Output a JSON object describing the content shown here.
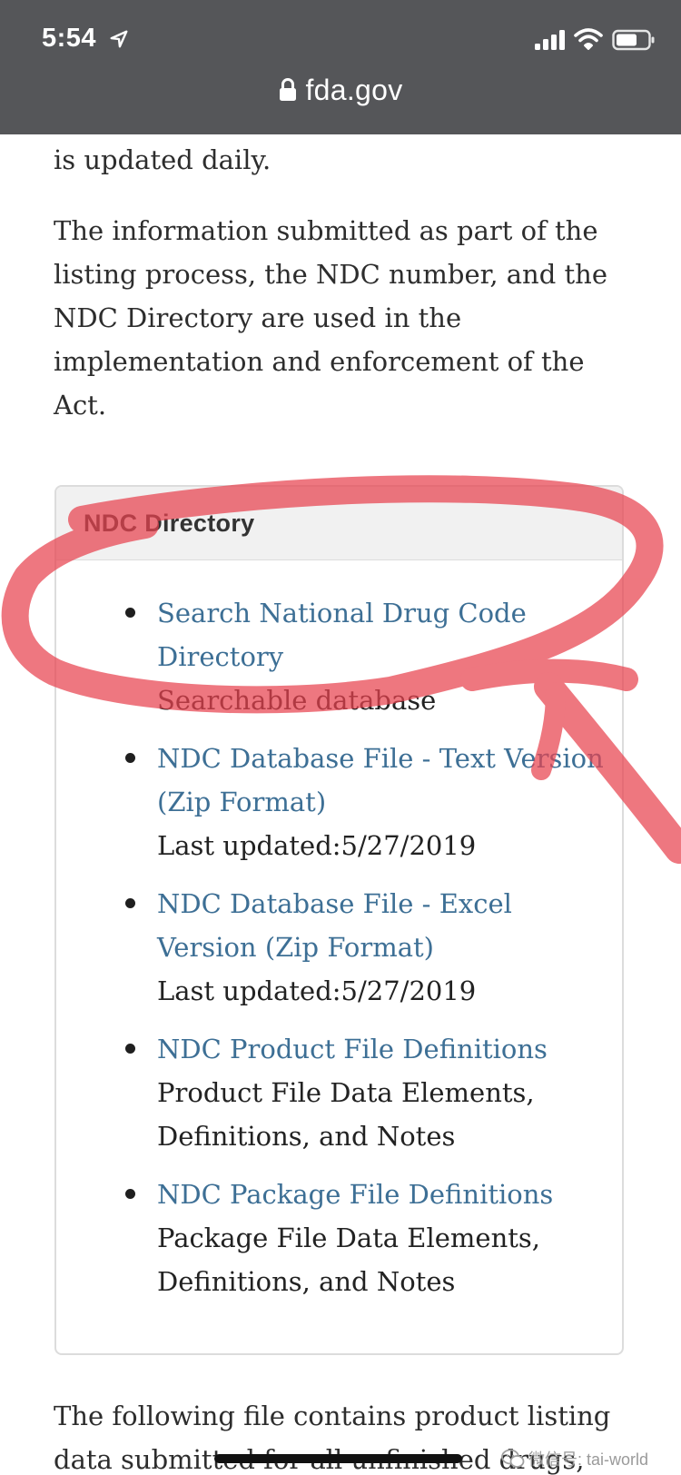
{
  "status_bar": {
    "time": "5:54",
    "icons": [
      "location-arrow-icon",
      "signal-icon",
      "wifi-icon",
      "battery-icon"
    ]
  },
  "browser": {
    "url": "fda.gov",
    "lock_icon": "lock-icon"
  },
  "content": {
    "para_top": "is updated daily.",
    "para_info": "The information submitted as part of the listing process, the NDC number, and the NDC Directory are used in the implementation and enforcement of the Act.",
    "para_bottom": "The following file contains product listing data submitted for all unfinished drugs,"
  },
  "card": {
    "title": "NDC Directory",
    "items": [
      {
        "link": "Search National Drug Code Directory",
        "desc": "Searchable database"
      },
      {
        "link": "NDC Database File - Text Version (Zip Format)",
        "desc": "Last updated:5/27/2019"
      },
      {
        "link": "NDC Database File - Excel Version (Zip Format)",
        "desc": "Last updated:5/27/2019"
      },
      {
        "link": "NDC Product File Definitions",
        "desc": "Product File Data Elements, Definitions, and Notes"
      },
      {
        "link": "NDC Package File Definitions",
        "desc": "Package File Data Elements, Definitions, and Notes"
      }
    ]
  },
  "watermark": {
    "text": "微信号: tai-world",
    "icon": "wechat-icon"
  },
  "colors": {
    "top_bar": "#555659",
    "link": "#3d6f95",
    "annotation": "#e8434f"
  }
}
